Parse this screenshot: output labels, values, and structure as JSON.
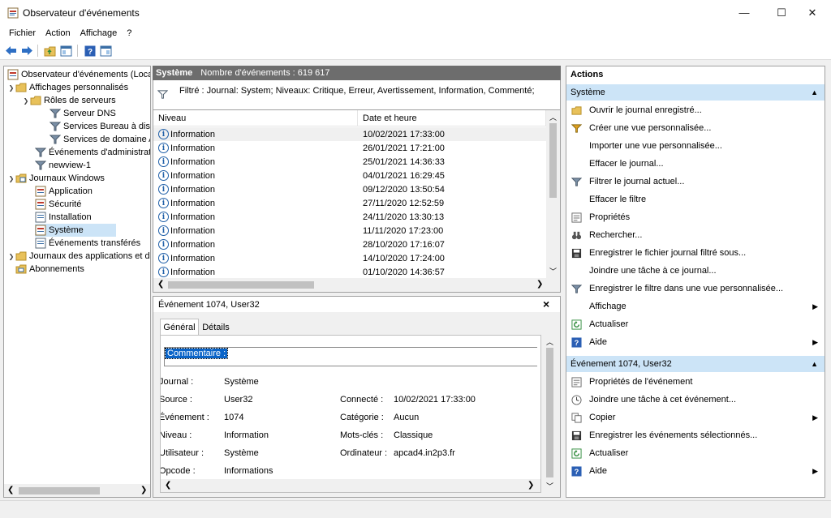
{
  "window": {
    "title": "Observateur d'événements",
    "minimize": "—",
    "maximize": "☐",
    "close": "✕"
  },
  "menu": [
    "Fichier",
    "Action",
    "Affichage",
    "?"
  ],
  "tree": {
    "root": "Observateur d'événements (Local)",
    "custom_views": "Affichages personnalisés",
    "server_roles": "Rôles de serveurs",
    "dns": "Serveur DNS",
    "rds": "Services Bureau à distance",
    "ad": "Services de domaine Active Directory",
    "admin_events": "Événements d'administration",
    "newview": "newview-1",
    "windows_logs": "Journaux Windows",
    "application": "Application",
    "security": "Sécurité",
    "setup": "Installation",
    "system": "Système",
    "forwarded": "Événements transférés",
    "apps_services": "Journaux des applications et des services",
    "subscriptions": "Abonnements"
  },
  "center": {
    "log_name": "Système",
    "count_label": "Nombre d'événements : 619 617",
    "filter_text": "Filtré : Journal: System; Niveaux: Critique, Erreur, Avertissement, Information, Commenté;",
    "col_level": "Niveau",
    "col_date": "Date et heure",
    "rows": [
      {
        "level": "Information",
        "date": "10/02/2021 17:33:00"
      },
      {
        "level": "Information",
        "date": "26/01/2021 17:21:00"
      },
      {
        "level": "Information",
        "date": "25/01/2021 14:36:33"
      },
      {
        "level": "Information",
        "date": "04/01/2021 16:29:45"
      },
      {
        "level": "Information",
        "date": "09/12/2020 13:50:54"
      },
      {
        "level": "Information",
        "date": "27/11/2020 12:52:59"
      },
      {
        "level": "Information",
        "date": "24/11/2020 13:30:13"
      },
      {
        "level": "Information",
        "date": "11/11/2020 17:23:00"
      },
      {
        "level": "Information",
        "date": "28/10/2020 17:16:07"
      },
      {
        "level": "Information",
        "date": "14/10/2020 17:24:00"
      },
      {
        "level": "Information",
        "date": "01/10/2020 14:36:57"
      }
    ]
  },
  "detail": {
    "title": "Événement 1074, User32",
    "close": "×",
    "tab_general": "Général",
    "tab_details": "Détails",
    "comment_label": "Commentaire :",
    "labels": {
      "journal": "Journal :",
      "source": "Source :",
      "event": "Événement :",
      "level": "Niveau :",
      "user": "Utilisateur :",
      "opcode": "Opcode :",
      "logged": "Connecté :",
      "category": "Catégorie :",
      "keywords": "Mots-clés :",
      "computer": "Ordinateur :"
    },
    "values": {
      "journal": "Système",
      "source": "User32",
      "event": "1074",
      "level": "Information",
      "user": "Système",
      "opcode": "Informations",
      "logged": "10/02/2021 17:33:00",
      "category": "Aucun",
      "keywords": "Classique",
      "computer": "apcad4.in2p3.fr"
    }
  },
  "actions": {
    "header": "Actions",
    "section1": "Système",
    "items1": [
      {
        "label": "Ouvrir le journal enregistré...",
        "icon": "open-folder-icon"
      },
      {
        "label": "Créer une vue personnalisée...",
        "icon": "filter-star-icon"
      },
      {
        "label": "Importer une vue personnalisée...",
        "icon": ""
      },
      {
        "label": "Effacer le journal...",
        "icon": ""
      },
      {
        "label": "Filtrer le journal actuel...",
        "icon": "filter-icon"
      },
      {
        "label": "Effacer le filtre",
        "icon": ""
      },
      {
        "label": "Propriétés",
        "icon": "properties-icon"
      },
      {
        "label": "Rechercher...",
        "icon": "binoculars-icon"
      },
      {
        "label": "Enregistrer le fichier journal filtré sous...",
        "icon": "save-icon"
      },
      {
        "label": "Joindre une tâche à ce journal...",
        "icon": ""
      },
      {
        "label": "Enregistrer le filtre dans une vue personnalisée...",
        "icon": "filter-save-icon"
      },
      {
        "label": "Affichage",
        "icon": "",
        "submenu": true
      },
      {
        "label": "Actualiser",
        "icon": "refresh-icon"
      },
      {
        "label": "Aide",
        "icon": "help-icon",
        "submenu": true
      }
    ],
    "section2": "Événement 1074, User32",
    "items2": [
      {
        "label": "Propriétés de l'événement",
        "icon": "properties-icon"
      },
      {
        "label": "Joindre une tâche à cet événement...",
        "icon": "task-icon"
      },
      {
        "label": "Copier",
        "icon": "copy-icon",
        "submenu": true
      },
      {
        "label": "Enregistrer les événements sélectionnés...",
        "icon": "save-icon"
      },
      {
        "label": "Actualiser",
        "icon": "refresh-icon"
      },
      {
        "label": "Aide",
        "icon": "help-icon",
        "submenu": true
      }
    ]
  }
}
